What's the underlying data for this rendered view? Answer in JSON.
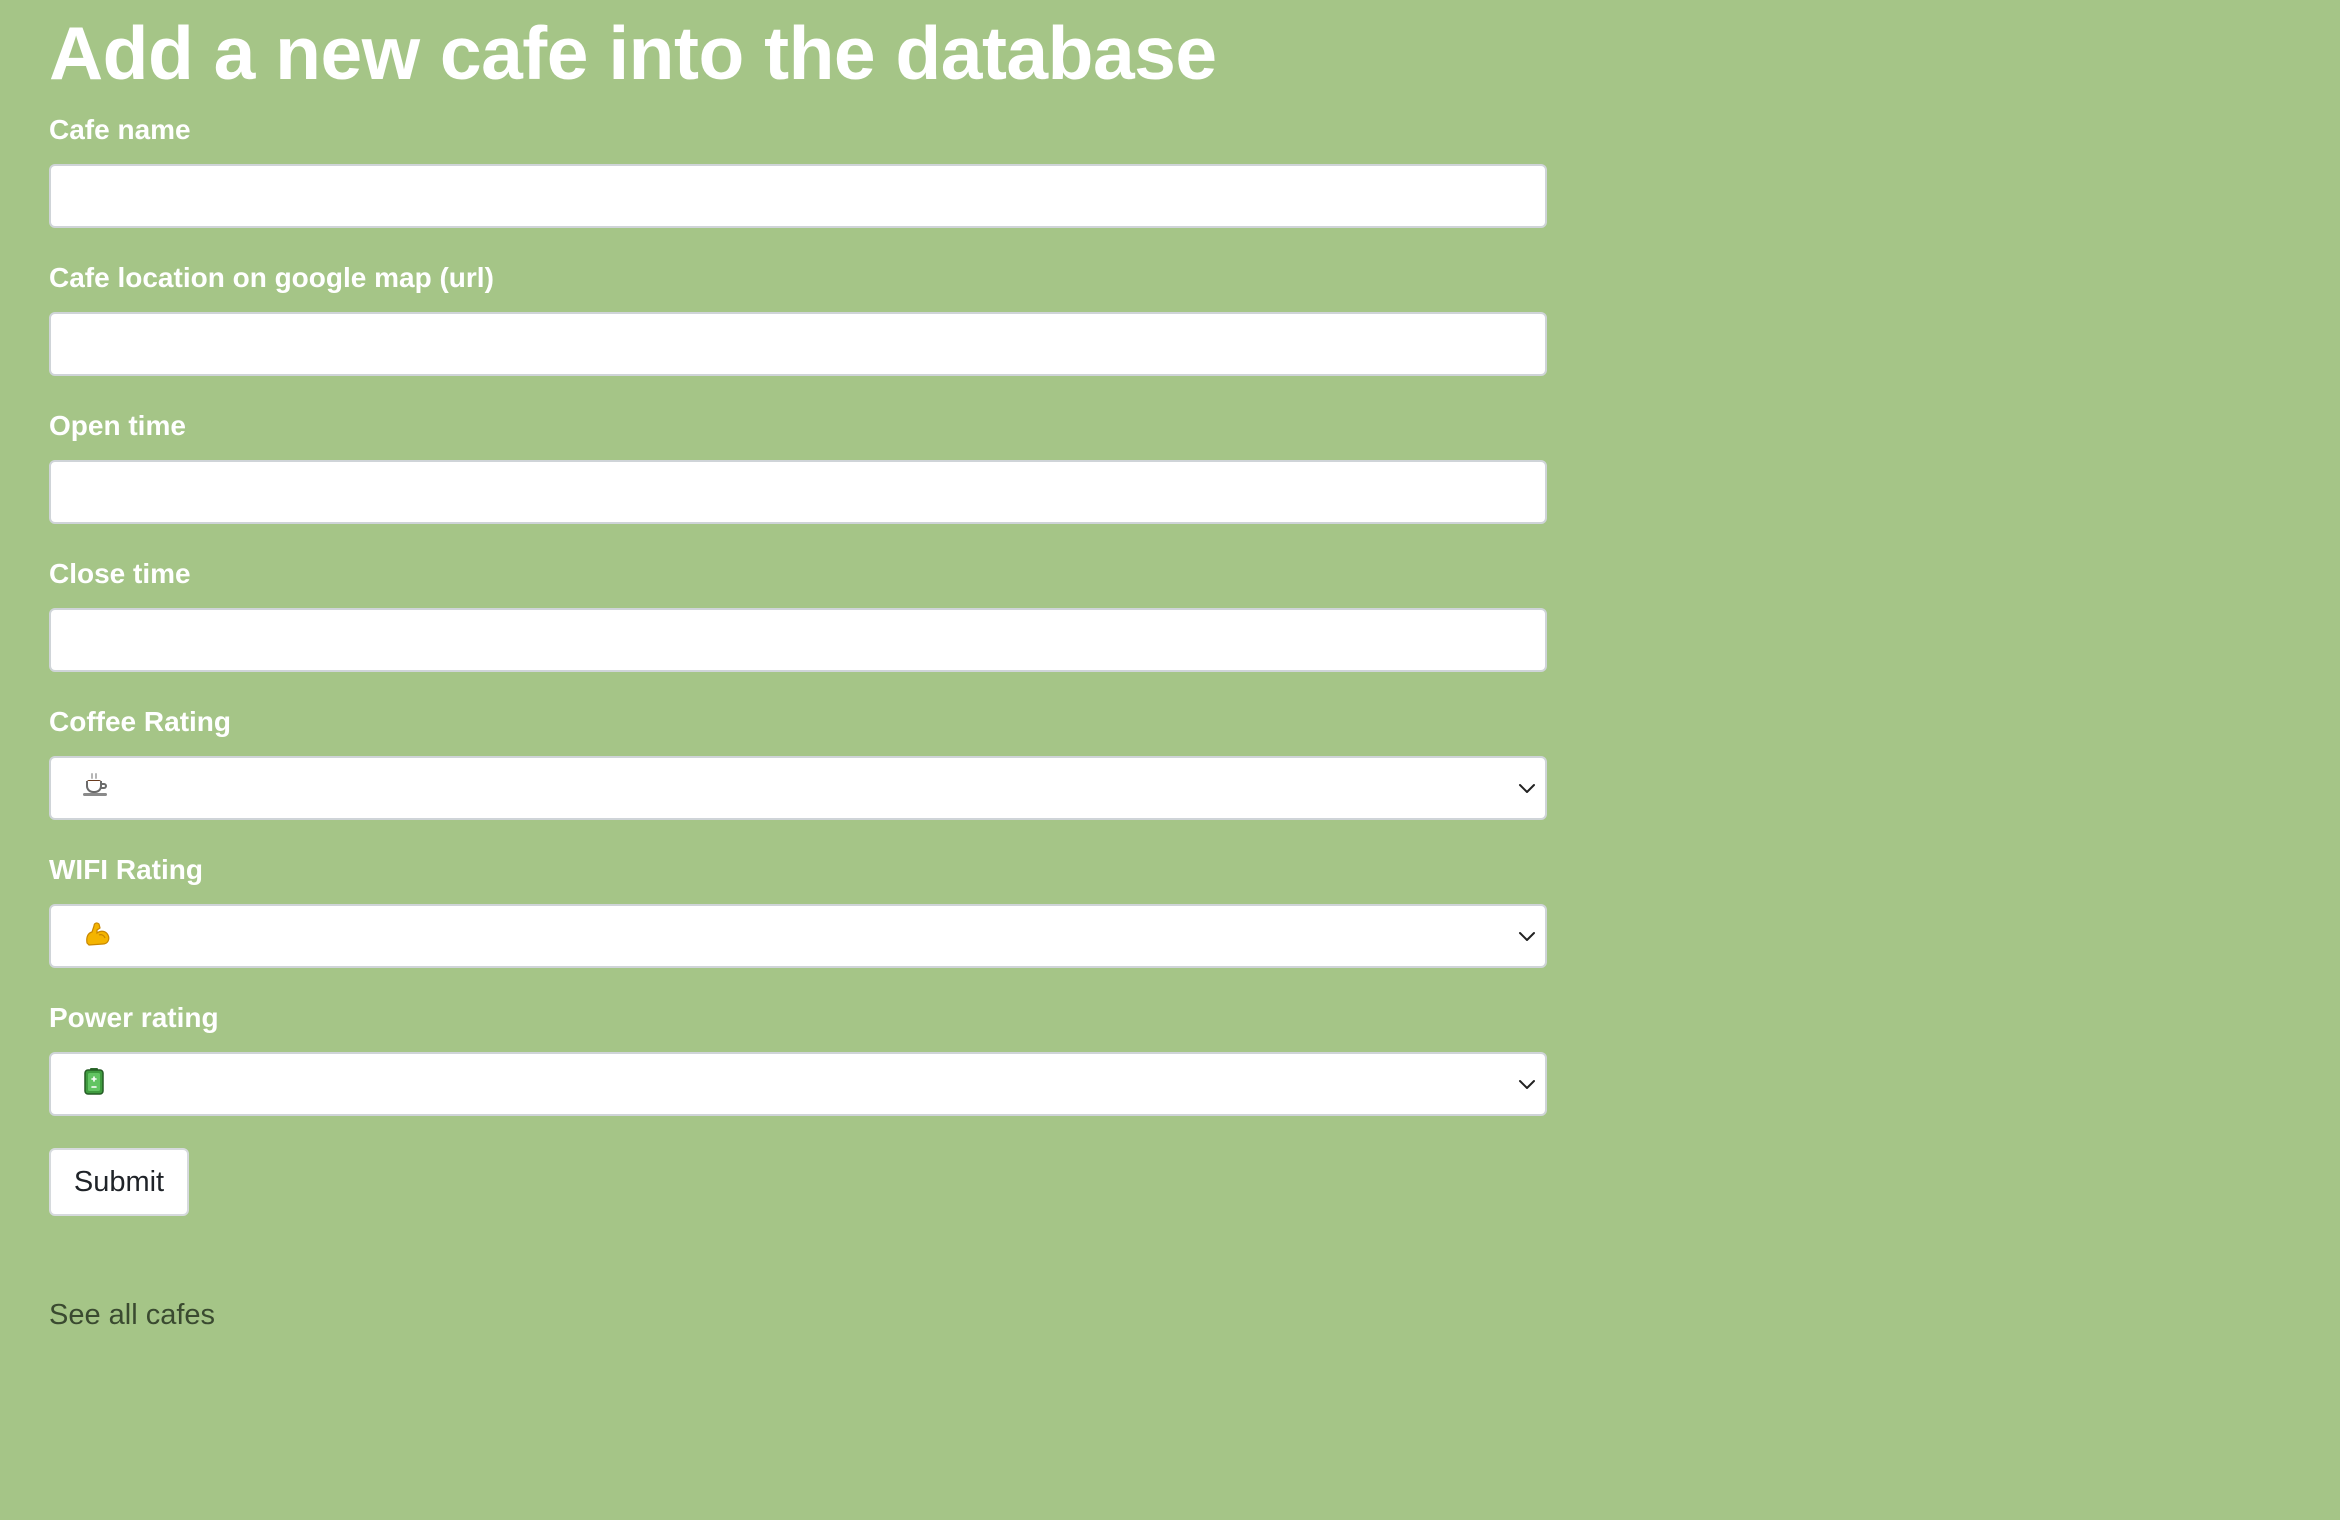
{
  "page": {
    "title": "Add a new cafe into the database"
  },
  "form": {
    "cafe_name": {
      "label": "Cafe name",
      "value": ""
    },
    "location": {
      "label": "Cafe location on google map (url)",
      "value": ""
    },
    "open_time": {
      "label": "Open time",
      "value": ""
    },
    "close_time": {
      "label": "Close time",
      "value": ""
    },
    "coffee_rating": {
      "label": "Coffee Rating",
      "selected": "☕",
      "icon": "coffee-cup-icon"
    },
    "wifi_rating": {
      "label": "WIFI Rating",
      "selected": "💪",
      "icon": "flexed-biceps-icon"
    },
    "power_rating": {
      "label": "Power rating",
      "selected": "🔋",
      "icon": "battery-icon"
    },
    "submit_label": "Submit"
  },
  "footer": {
    "see_all_link": "See all cafes"
  },
  "colors": {
    "background": "#a5c587",
    "label_text": "#ffffff",
    "link_text": "#3a4a30"
  }
}
